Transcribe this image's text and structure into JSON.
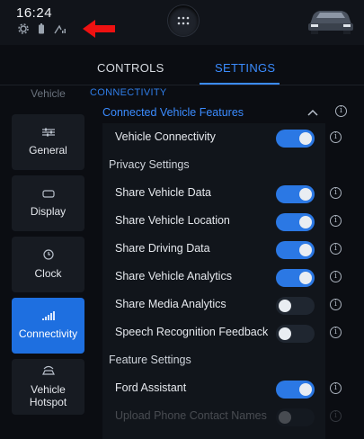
{
  "status": {
    "time": "16:24"
  },
  "tabs": [
    {
      "label": "CONTROLS"
    },
    {
      "label": "SETTINGS"
    }
  ],
  "sidebar": {
    "items": [
      {
        "label": "Vehicle",
        "icon": "car-icon"
      },
      {
        "label": "General",
        "icon": "sliders-icon"
      },
      {
        "label": "Display",
        "icon": "display-icon"
      },
      {
        "label": "Clock",
        "icon": "clock-icon"
      },
      {
        "label": "Connectivity",
        "icon": "signal-icon"
      },
      {
        "label": "Vehicle\nHotspot",
        "icon": "hotspot-icon"
      }
    ]
  },
  "content": {
    "section_title": "CONNECTIVITY",
    "group_title": "Connected Vehicle Features",
    "rows": [
      {
        "label": "Vehicle Connectivity",
        "type": "toggle",
        "on": true
      },
      {
        "label": "Privacy Settings",
        "type": "subhead"
      },
      {
        "label": "Share Vehicle Data",
        "type": "toggle",
        "on": true
      },
      {
        "label": "Share Vehicle Location",
        "type": "toggle",
        "on": true
      },
      {
        "label": "Share Driving Data",
        "type": "toggle",
        "on": true
      },
      {
        "label": "Share Vehicle Analytics",
        "type": "toggle",
        "on": true
      },
      {
        "label": "Share Media Analytics",
        "type": "toggle",
        "on": false
      },
      {
        "label": "Speech Recognition Feedback",
        "type": "toggle",
        "on": false
      },
      {
        "label": "Feature Settings",
        "type": "subhead"
      },
      {
        "label": "Ford Assistant",
        "type": "toggle",
        "on": true
      },
      {
        "label": "Upload Phone Contact Names",
        "type": "toggle",
        "on": false
      }
    ]
  },
  "colors": {
    "accent": "#2b78e4",
    "highlight": "#3b8cff",
    "annotation_arrow": "#e11"
  }
}
